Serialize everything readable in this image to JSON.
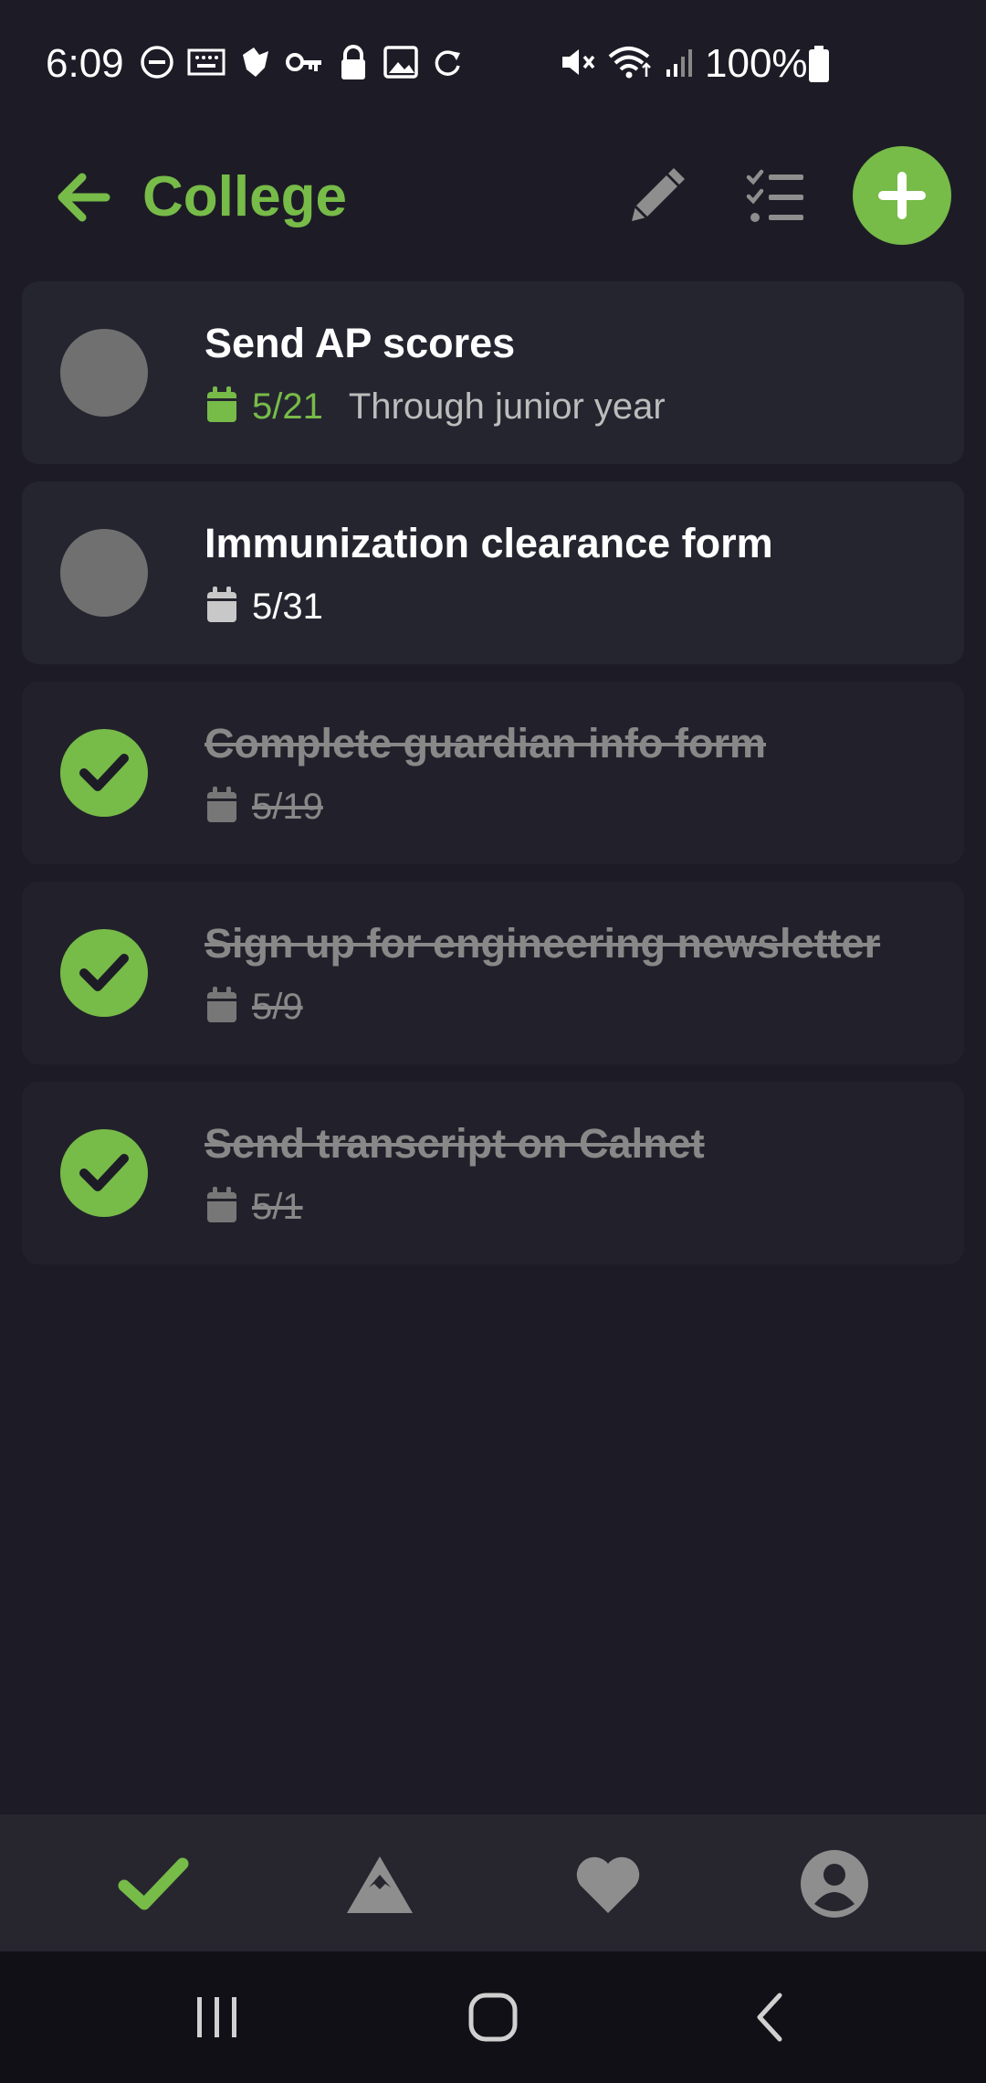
{
  "status_bar": {
    "time": "6:09",
    "battery": "100%"
  },
  "header": {
    "title": "College"
  },
  "tasks": [
    {
      "title": "Send AP scores",
      "date": "5/21",
      "note": "Through junior year",
      "completed": false,
      "date_highlight": true
    },
    {
      "title": "Immunization clearance form",
      "date": "5/31",
      "note": "",
      "completed": false,
      "date_highlight": false
    },
    {
      "title": "Complete guardian info form",
      "date": "5/19",
      "note": "",
      "completed": true,
      "date_highlight": false
    },
    {
      "title": "Sign up for engineering newsletter",
      "date": "5/9",
      "note": "",
      "completed": true,
      "date_highlight": false
    },
    {
      "title": "Send transcript on Calnet",
      "date": "5/1",
      "note": "",
      "completed": true,
      "date_highlight": false
    }
  ],
  "bottom_nav": {
    "items": [
      {
        "icon": "check-icon",
        "active": true
      },
      {
        "icon": "mountain-icon",
        "active": false
      },
      {
        "icon": "heart-icon",
        "active": false
      },
      {
        "icon": "account-icon",
        "active": false
      }
    ]
  },
  "system_nav": {
    "items": [
      "recent-apps-icon",
      "home-icon",
      "back-icon"
    ]
  },
  "colors": {
    "background": "#1d1c26",
    "accent": "#77bb48",
    "card": "#252530",
    "muted": "#888888"
  }
}
